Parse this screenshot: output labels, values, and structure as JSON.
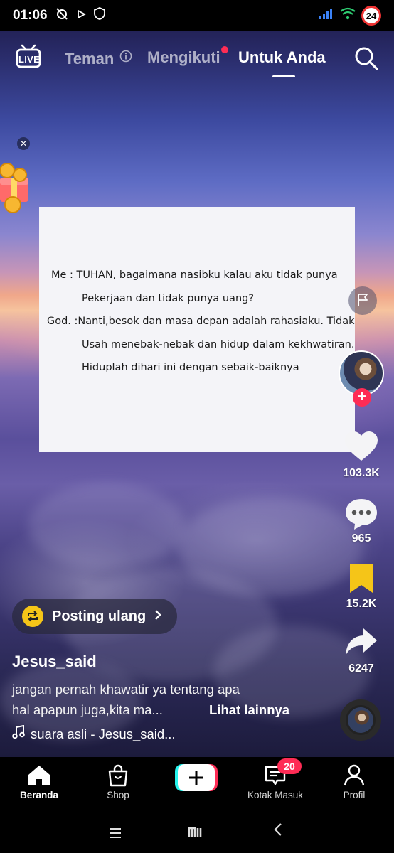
{
  "status_bar": {
    "time": "01:06",
    "battery": "24"
  },
  "top_nav": {
    "live_label": "LIVE",
    "tabs": [
      {
        "label": "Teman"
      },
      {
        "label": "Mengikuti"
      },
      {
        "label": "Untuk Anda"
      }
    ]
  },
  "video_card": {
    "lines": [
      "Me : TUHAN, bagaimana nasibku kalau aku tidak punya",
      "Pekerjaan dan tidak punya uang?",
      "God.  :Nanti,besok dan masa depan adalah rahasiaku. Tidak",
      "Usah menebak-nebak  dan hidup dalam kekhwatiran.",
      "Hiduplah dihari ini dengan sebaik-baiknya"
    ]
  },
  "actions": {
    "likes": "103.3K",
    "comments": "965",
    "saves": "15.2K",
    "shares": "6247"
  },
  "repost": {
    "label": "Posting ulang"
  },
  "post": {
    "username": "Jesus_said",
    "caption_line1": "jangan pernah khawatir ya tentang apa",
    "caption_line2": "hal apapun juga,kita ma...",
    "see_more": "Lihat lainnya",
    "sound": "suara asli - Jesus_said..."
  },
  "bottom_nav": {
    "home": "Beranda",
    "shop": "Shop",
    "inbox": "Kotak Masuk",
    "inbox_badge": "20",
    "profile": "Profil"
  },
  "colors": {
    "accent": "#fe2c55",
    "save": "#f5c518",
    "repost_icon": "#f5c518"
  }
}
